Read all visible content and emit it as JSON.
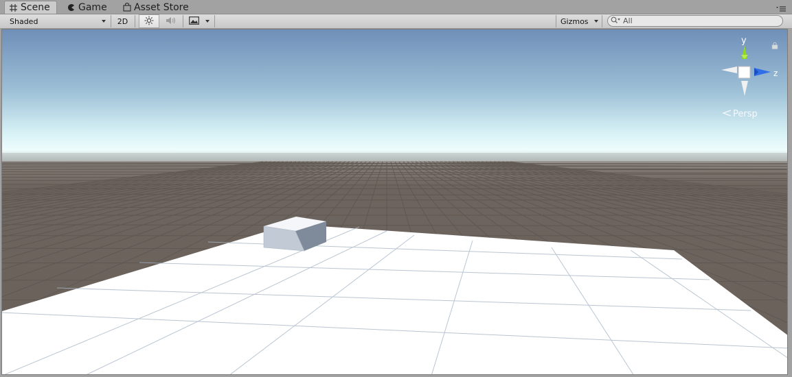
{
  "tabs": [
    {
      "label": "Scene",
      "icon": "scene-grid-icon",
      "active": true
    },
    {
      "label": "Game",
      "icon": "game-pacman-icon",
      "active": false
    },
    {
      "label": "Asset Store",
      "icon": "asset-store-bag-icon",
      "active": false
    }
  ],
  "toolbar": {
    "draw_mode": "Shaded",
    "mode_2d": "2D",
    "lighting_icon": "sun-icon",
    "audio_icon": "speaker-icon",
    "effects_icon": "image-icon",
    "gizmos_label": "Gizmos",
    "search_value": "All"
  },
  "scene_gizmo": {
    "y_label": "y",
    "z_label": "z",
    "projection_label": "Persp"
  },
  "colors": {
    "y_axis": "#8cd91e",
    "z_axis": "#2f6ee6",
    "sky_top": "#6e8fb8",
    "horizon": "#e8f8f8",
    "ground": "#6b625c",
    "plane": "#ffffff",
    "cube": "#c4ccd8"
  }
}
